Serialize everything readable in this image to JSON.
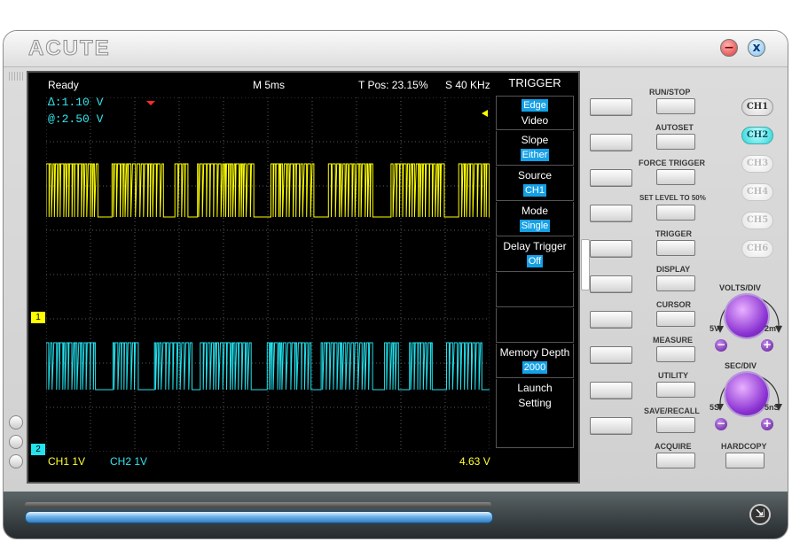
{
  "app": {
    "logo": "ACUTE",
    "minimize": "−",
    "close": "x"
  },
  "status": {
    "state": "Ready",
    "timebase": "M 5ms",
    "trigger_pos": "T Pos: 23.15%",
    "sample_rate": "S 40 KHz",
    "cursor_delta": "∆:1.10 V",
    "cursor_at": "@:2.50 V",
    "ch1_scale": "CH1  1V",
    "ch2_scale": "CH2  1V",
    "measure_value": "4.63 V",
    "ch1_marker": "1",
    "ch2_marker": "2"
  },
  "trigger_menu": {
    "title": "TRIGGER",
    "items": [
      {
        "label": "Edge",
        "value": "Video",
        "highlight": "top"
      },
      {
        "label": "Slope",
        "value": "Either"
      },
      {
        "label": "Source",
        "value": "CH1"
      },
      {
        "label": "Mode",
        "value": "Single"
      },
      {
        "label": "Delay Trigger",
        "value": "Off"
      },
      {
        "label": "",
        "value": ""
      },
      {
        "label": "",
        "value": ""
      },
      {
        "label": "Memory Depth",
        "value": "2000"
      },
      {
        "label": "Launch",
        "value": "Setting"
      }
    ]
  },
  "function_buttons": {
    "run_stop": "RUN/STOP",
    "autoset": "AUTOSET",
    "force_trigger": "FORCE TRIGGER",
    "set_level": "SET LEVEL TO 50%",
    "trigger": "TRIGGER",
    "display": "DISPLAY",
    "cursor": "CURSOR",
    "measure": "MEASURE",
    "utility": "UTILITY",
    "save_recall": "SAVE/RECALL",
    "acquire": "ACQUIRE",
    "hardcopy": "HARDCOPY"
  },
  "channels": [
    {
      "label": "CH1",
      "state": "on"
    },
    {
      "label": "CH2",
      "state": "active"
    },
    {
      "label": "CH3",
      "state": "disabled"
    },
    {
      "label": "CH4",
      "state": "disabled"
    },
    {
      "label": "CH5",
      "state": "disabled"
    },
    {
      "label": "CH6",
      "state": "disabled"
    }
  ],
  "volts_div": {
    "title": "VOLTS/DIV",
    "min": "5V",
    "max": "2mV",
    "minus": "−",
    "plus": "+"
  },
  "sec_div": {
    "title": "SEC/DIV",
    "min": "5S",
    "max": "5nS",
    "minus": "−",
    "plus": "+"
  },
  "colors": {
    "ch1": "#ffff00",
    "ch2": "#22e2ee",
    "highlight": "#15a0e6",
    "knob": "#8a32d2"
  },
  "icons": {
    "bottom_right": "collapse-icon"
  }
}
